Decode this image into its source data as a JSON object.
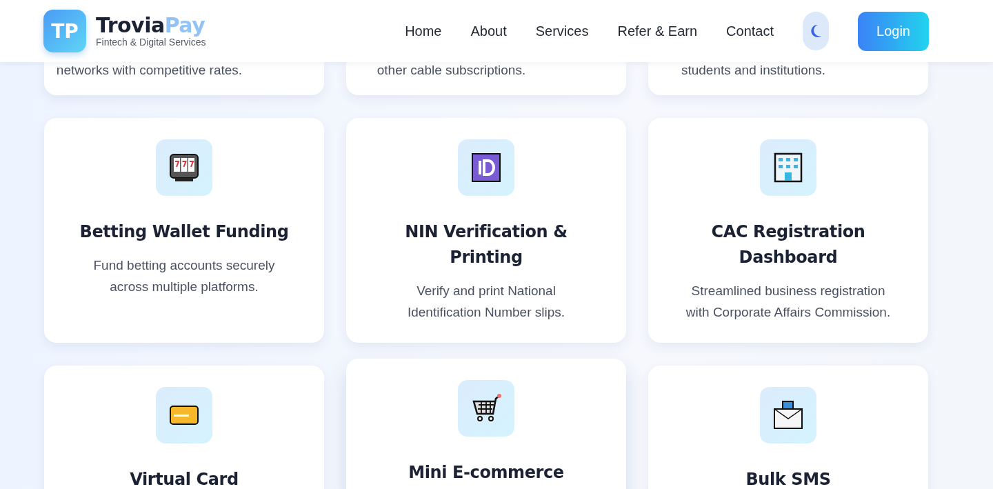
{
  "brand": {
    "initials": "TP",
    "name": "Trovia",
    "accent": "Pay",
    "tagline": "Fintech & Digital Services"
  },
  "nav": [
    {
      "label": "Home"
    },
    {
      "label": "About"
    },
    {
      "label": "Services"
    },
    {
      "label": "Refer & Earn"
    },
    {
      "label": "Contact"
    }
  ],
  "login_button": "Login",
  "partial_cards": [
    {
      "description": "networks with competitive rates."
    },
    {
      "description": "other cable subscriptions."
    },
    {
      "description": "students and institutions."
    }
  ],
  "cards": [
    {
      "kind": "slot-machine",
      "title": "Betting Wallet Funding",
      "description": "Fund betting accounts securely across multiple platforms.",
      "hovered": false
    },
    {
      "kind": "id",
      "title": "NIN Verification & Printing",
      "description": "Verify and print National Identification Number slips.",
      "hovered": false
    },
    {
      "kind": "building",
      "title": "CAC Registration Dashboard",
      "description": "Streamlined business registration with Corporate Affairs Commission.",
      "hovered": false
    },
    {
      "kind": "card",
      "title": "Virtual Card",
      "hovered": false
    },
    {
      "kind": "cart",
      "title": "Mini E-commerce",
      "hovered": true
    },
    {
      "kind": "envelope",
      "title": "Bulk SMS",
      "hovered": false
    }
  ]
}
